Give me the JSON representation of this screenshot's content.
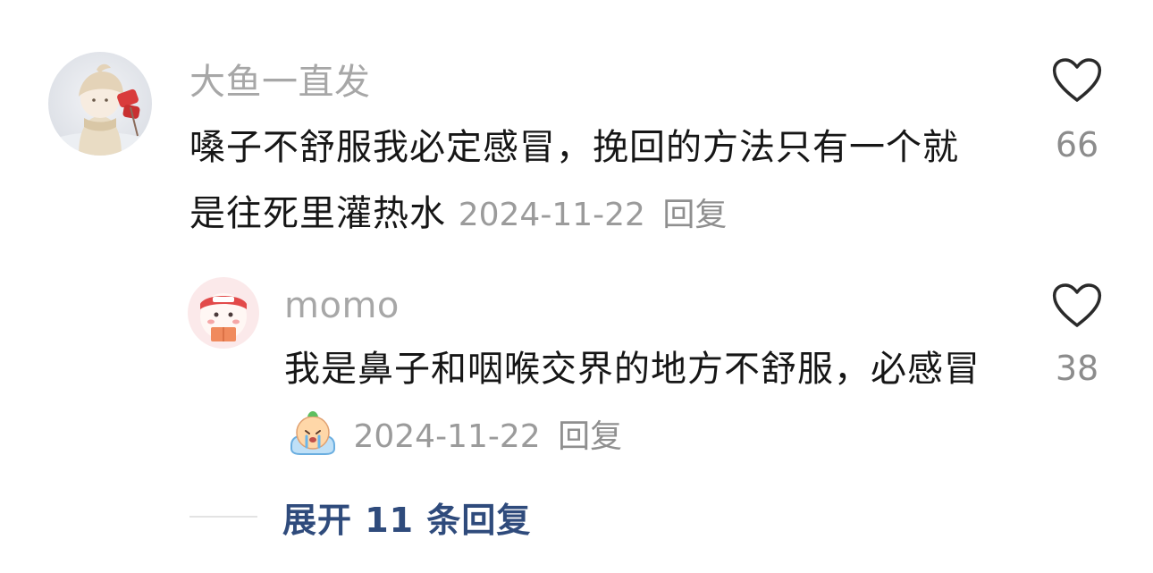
{
  "comments": [
    {
      "username": "大鱼一直发",
      "text": "嗓子不舒服我必定感冒，挽回的方法只有一个就是往死里灌热水",
      "date": "2024-11-22",
      "reply_label": "回复",
      "likes": "66"
    }
  ],
  "replies": [
    {
      "username": "momo",
      "text": "我是鼻子和咽喉交界的地方不舒服，必感冒",
      "emoji": "crying-emoji",
      "date": "2024-11-22",
      "reply_label": "回复",
      "likes": "38"
    }
  ],
  "expand_label": "展开 11 条回复",
  "colors": {
    "username": "#a7a7a7",
    "text": "#161616",
    "meta": "#9b9b9b",
    "expand": "#2f4b7c",
    "divider": "#e3e3e3"
  }
}
